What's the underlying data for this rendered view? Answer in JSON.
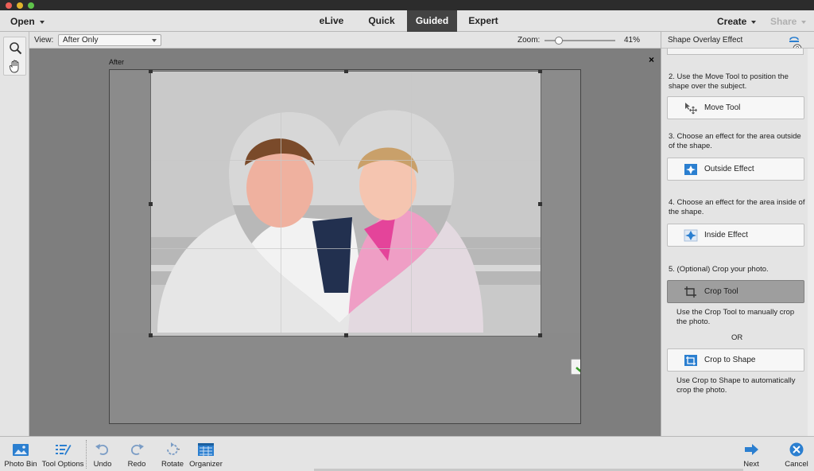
{
  "menus": {
    "open_label": "Open",
    "create_label": "Create",
    "share_label": "Share"
  },
  "mode_tabs": [
    {
      "label": "eLive",
      "active": false
    },
    {
      "label": "Quick",
      "active": false
    },
    {
      "label": "Guided",
      "active": true
    },
    {
      "label": "Expert",
      "active": false
    }
  ],
  "tools": [
    {
      "name": "zoom-tool",
      "icon": "magnifier-icon"
    },
    {
      "name": "hand-tool",
      "icon": "hand-icon"
    }
  ],
  "options_bar": {
    "view_label": "View:",
    "view_value": "After Only",
    "zoom_label": "Zoom:",
    "zoom_value": "41%",
    "zoom_fraction": 0.41
  },
  "canvas": {
    "after_label": "After",
    "close_symbol": "×"
  },
  "panel": {
    "title": "Shape Overlay Effect",
    "step2_text": "2. Use the Move Tool to position the shape over the subject.",
    "move_tool_label": "Move Tool",
    "step3_text": "3. Choose an effect for the area outside of the shape.",
    "outside_effect_label": "Outside Effect",
    "step4_text": "4. Choose an effect for the area inside of the shape.",
    "inside_effect_label": "Inside Effect",
    "step5_text": "5. (Optional) Crop your photo.",
    "crop_tool_label": "Crop Tool",
    "crop_tool_help": "Use the Crop Tool to manually crop the photo.",
    "or_text": "OR",
    "crop_to_shape_label": "Crop to Shape",
    "crop_to_shape_help": "Use Crop to Shape to automatically crop the photo."
  },
  "bottom_bar": {
    "photo_bin": "Photo Bin",
    "tool_options": "Tool Options",
    "undo": "Undo",
    "redo": "Redo",
    "rotate": "Rotate",
    "organizer": "Organizer",
    "next": "Next",
    "cancel": "Cancel"
  },
  "colors": {
    "active_tab_bg": "#434343",
    "accent_blue": "#2b7fd0",
    "canvas_bg": "#7e7e7e"
  }
}
